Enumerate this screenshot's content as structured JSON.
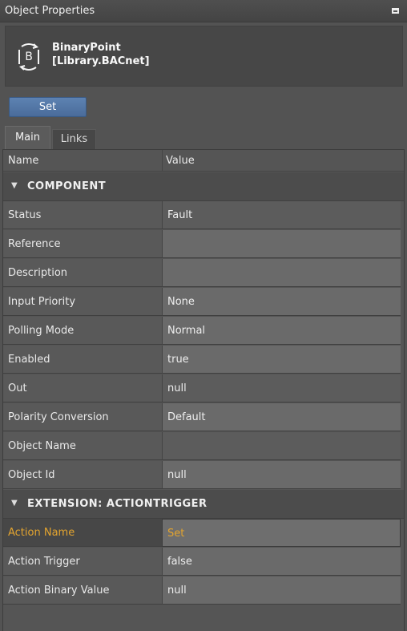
{
  "panel": {
    "title": "Object Properties"
  },
  "object": {
    "name_line1": "BinaryPoint",
    "name_line2": "[Library.BACnet]",
    "icon_letter": "B"
  },
  "toolbar": {
    "set_label": "Set"
  },
  "tabs": [
    {
      "label": "Main"
    },
    {
      "label": "Links"
    }
  ],
  "columns": {
    "name": "Name",
    "value": "Value"
  },
  "groups": [
    {
      "label": "COMPONENT"
    },
    {
      "label": "EXTENSION: ACTIONTRIGGER"
    }
  ],
  "component_rows": [
    {
      "name": "Status",
      "value": "Fault"
    },
    {
      "name": "Reference",
      "value": ""
    },
    {
      "name": "Description",
      "value": ""
    },
    {
      "name": "Input Priority",
      "value": "None"
    },
    {
      "name": "Polling Mode",
      "value": "Normal"
    },
    {
      "name": "Enabled",
      "value": "true"
    },
    {
      "name": "Out",
      "value": "null"
    },
    {
      "name": "Polarity Conversion",
      "value": "Default"
    },
    {
      "name": "Object Name",
      "value": ""
    },
    {
      "name": "Object Id",
      "value": "null"
    }
  ],
  "extension_rows": [
    {
      "name": "Action Name",
      "value": "Set"
    },
    {
      "name": "Action Trigger",
      "value": "false"
    },
    {
      "name": "Action Binary Value",
      "value": "null"
    }
  ],
  "colors": {
    "highlight": "#e3a42f",
    "button": "#5d82b2"
  },
  "icons": {
    "pin": "pin-icon",
    "object": "binary-point-icon",
    "expand": "chevron-down-icon"
  }
}
